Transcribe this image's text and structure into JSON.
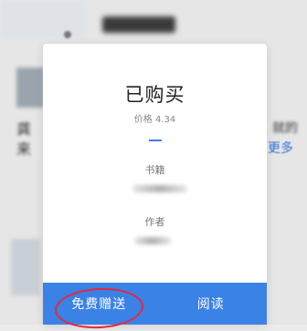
{
  "dialog": {
    "title": "已购买",
    "price_text": "价格 4.34",
    "book_label": "书籍",
    "author_label": "作者"
  },
  "actions": {
    "gift_label": "免费赠送",
    "read_label": "阅读"
  },
  "background": {
    "fragment_left_1": "龚",
    "fragment_left_2": "来",
    "fragment_right": "就的",
    "more_link": "更多"
  },
  "colors": {
    "accent": "#3b82e6",
    "annotation": "#e5283a"
  }
}
